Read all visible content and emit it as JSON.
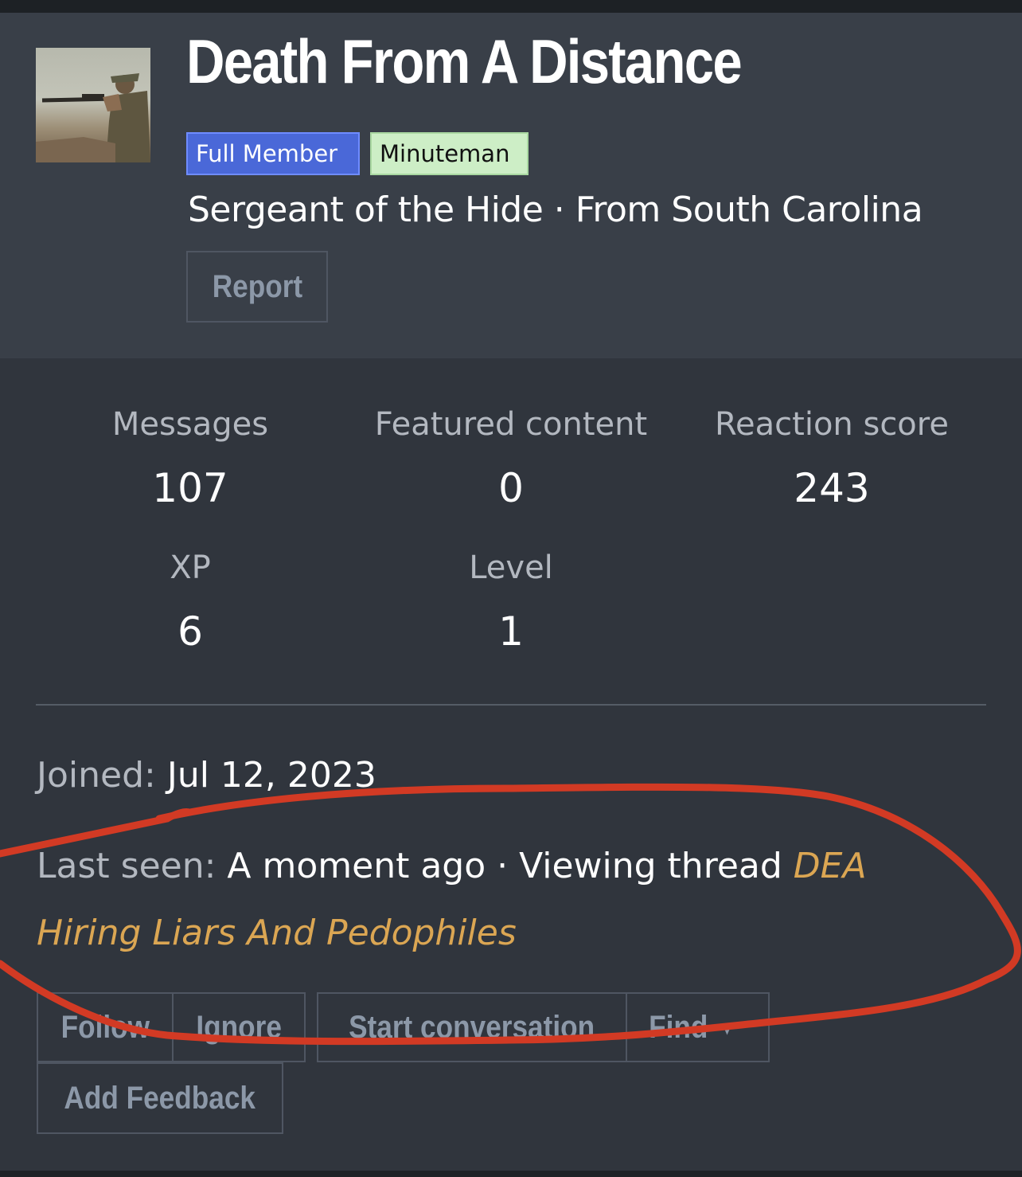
{
  "profile": {
    "name": "Death From A Distance",
    "avatar_alt": "avatar",
    "badges": [
      "Full Member",
      "Minuteman"
    ],
    "subtitle": "Sergeant of the Hide · From South Carolina",
    "report_label": "Report"
  },
  "stats": {
    "messages_label": "Messages",
    "messages_value": "107",
    "featured_label": "Featured content",
    "featured_value": "0",
    "reaction_label": "Reaction score",
    "reaction_value": "243",
    "xp_label": "XP",
    "xp_value": "6",
    "level_label": "Level",
    "level_value": "1"
  },
  "info": {
    "joined_label": "Joined:",
    "joined_value": "Jul 12, 2023",
    "last_seen_label": "Last seen:",
    "last_seen_value": "A moment ago · Viewing thread",
    "thread_line1": "DEA",
    "thread_line2": "Hiring Liars And Pedophiles"
  },
  "actions": {
    "follow": "Follow",
    "ignore": "Ignore",
    "start_conversation": "Start conversation",
    "find": "Find",
    "add_feedback": "Add Feedback"
  },
  "colors": {
    "header_bg": "#393f48",
    "panel_bg": "#30353d",
    "full_member_badge": "#4a68d8",
    "minuteman_badge": "#cdeec6",
    "link": "#dba653",
    "annotation_ink": "#d23a24"
  }
}
